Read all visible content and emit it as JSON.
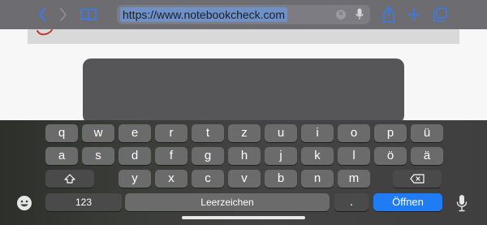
{
  "browser": {
    "url": "https://www.notebookcheck.com",
    "back_icon": "chevron-left-icon",
    "forward_icon": "chevron-right-icon",
    "bookmarks_icon": "book-icon",
    "share_icon": "share-icon",
    "new_tab_icon": "plus-icon",
    "tabs_icon": "tabs-icon",
    "accent_color": "#3a7bf0"
  },
  "keyboard": {
    "row1": [
      "q",
      "w",
      "e",
      "r",
      "t",
      "z",
      "u",
      "i",
      "o",
      "p",
      "ü"
    ],
    "row2": [
      "a",
      "s",
      "d",
      "f",
      "g",
      "h",
      "j",
      "k",
      "l",
      "ö",
      "ä"
    ],
    "row3": [
      "y",
      "x",
      "c",
      "v",
      "b",
      "n",
      "m"
    ],
    "numbers_label": "123",
    "space_label": "Leerzeichen",
    "period_label": ".",
    "go_label": "Öffnen",
    "go_color": "#1f7cf5"
  }
}
